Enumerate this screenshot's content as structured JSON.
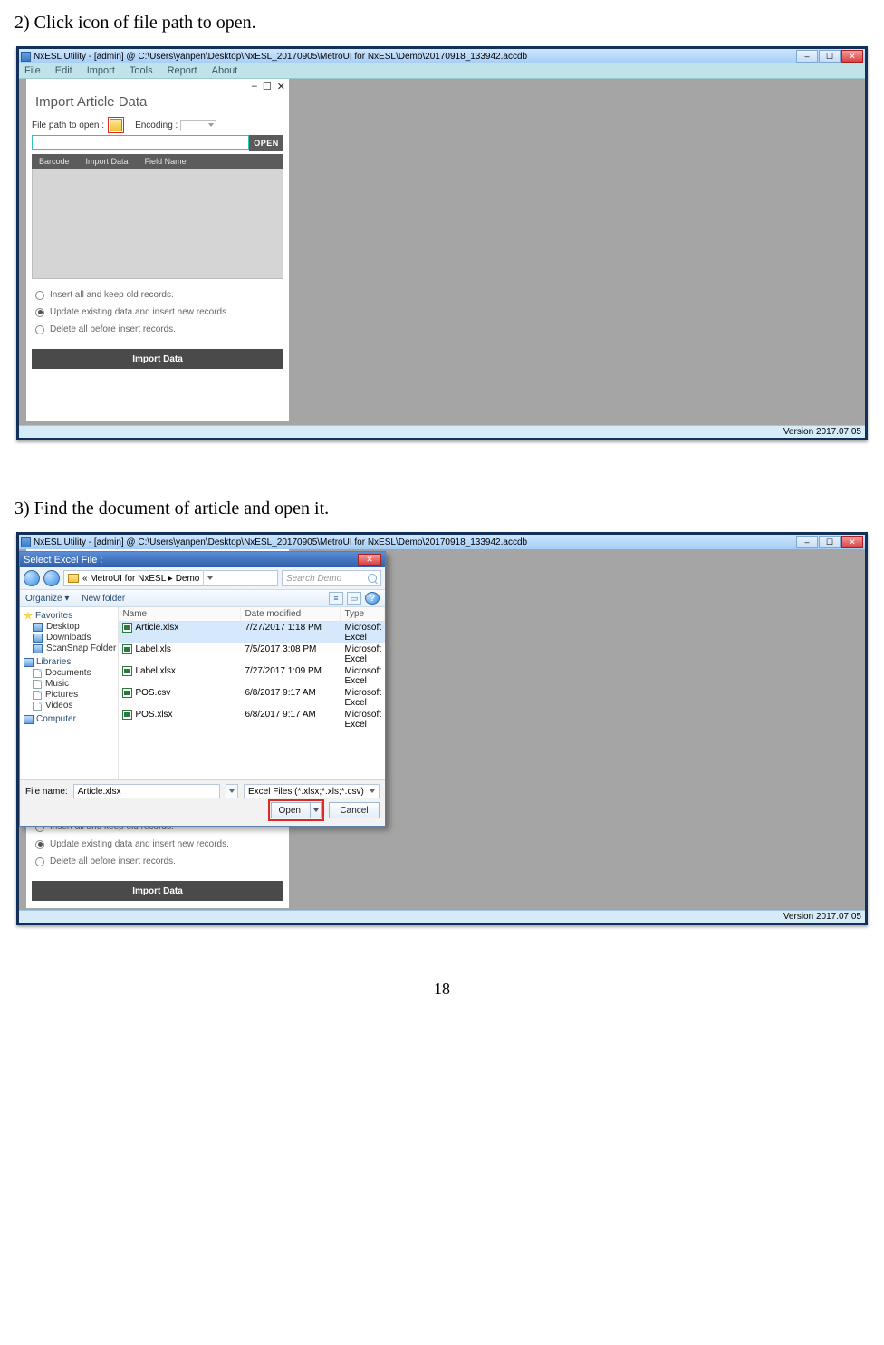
{
  "doc": {
    "step2": "2) Click icon of file path to open.",
    "step3": "3) Find the document of article and open it.",
    "page_num": "18"
  },
  "app": {
    "title": "NxESL Utility - [admin] @ C:\\Users\\yanpen\\Desktop\\NxESL_20170905\\MetroUI for NxESL\\Demo\\20170918_133942.accdb",
    "menus": [
      "File",
      "Edit",
      "Import",
      "Tools",
      "Report",
      "About"
    ],
    "status": "Version 2017.07.05"
  },
  "panel": {
    "title": "Import Article Data",
    "path_label": "File path to open :",
    "encoding_label": "Encoding :",
    "open_btn": "OPEN",
    "tabs": [
      "Barcode",
      "Import Data",
      "Field Name"
    ],
    "options": {
      "o1": "Insert all and keep old records.",
      "o2": "Update existing data and insert new records.",
      "o3": "Delete all before insert records."
    },
    "import_btn": "Import Data",
    "win_min": "–",
    "win_max": "☐",
    "win_close": "✕"
  },
  "dialog": {
    "title": "Select Excel File :",
    "crumb_prefix": "«  MetroUI for NxESL  ▸  ",
    "crumb_last": "Demo",
    "search_placeholder": "Search Demo",
    "organize": "Organize ▾",
    "newfolder": "New folder",
    "nav": {
      "favorites": "Favorites",
      "fav_items": [
        "Desktop",
        "Downloads",
        "ScanSnap Folder"
      ],
      "libraries": "Libraries",
      "lib_items": [
        "Documents",
        "Music",
        "Pictures",
        "Videos"
      ],
      "computer": "Computer"
    },
    "cols": {
      "name": "Name",
      "date": "Date modified",
      "type": "Type"
    },
    "files": [
      {
        "name": "Article.xlsx",
        "date": "7/27/2017 1:18 PM",
        "type": "Microsoft Excel"
      },
      {
        "name": "Label.xls",
        "date": "7/5/2017 3:08 PM",
        "type": "Microsoft Excel"
      },
      {
        "name": "Label.xlsx",
        "date": "7/27/2017 1:09 PM",
        "type": "Microsoft Excel"
      },
      {
        "name": "POS.csv",
        "date": "6/8/2017 9:17 AM",
        "type": "Microsoft Excel"
      },
      {
        "name": "POS.xlsx",
        "date": "6/8/2017 9:17 AM",
        "type": "Microsoft Excel"
      }
    ],
    "filename_label": "File name:",
    "filename_value": "Article.xlsx",
    "filter": "Excel Files (*.xlsx;*.xls;*.csv)",
    "open": "Open",
    "cancel": "Cancel"
  }
}
